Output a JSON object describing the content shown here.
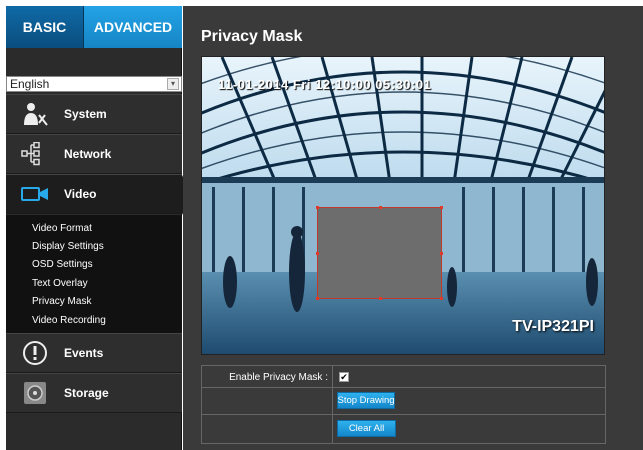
{
  "tabs": {
    "basic": "BASIC",
    "advanced": "ADVANCED"
  },
  "language": {
    "selected": "English"
  },
  "menu": {
    "system": {
      "label": "System",
      "icon": "wrench-person-icon"
    },
    "network": {
      "label": "Network",
      "icon": "network-icon"
    },
    "video": {
      "label": "Video",
      "icon": "video-camera-icon"
    },
    "events": {
      "label": "Events",
      "icon": "exclamation-icon"
    },
    "storage": {
      "label": "Storage",
      "icon": "disk-icon"
    }
  },
  "video_submenu": [
    "Video Format",
    "Display Settings",
    "OSD Settings",
    "Text Overlay",
    "Privacy Mask",
    "Video Recording"
  ],
  "page": {
    "title": "Privacy Mask"
  },
  "video": {
    "timestamp": "11-01-2014 Fri 12:10:00 05:30:01",
    "camera_label": "TV-IP321PI"
  },
  "settings": {
    "enable_label": "Enable Privacy Mask :",
    "enable_checked": true,
    "stop_drawing": "Stop Drawing",
    "clear_all": "Clear All"
  },
  "colors": {
    "accent": "#1f9ee0",
    "sidebar": "#2b2b2b",
    "mask_border": "#c0392b"
  }
}
